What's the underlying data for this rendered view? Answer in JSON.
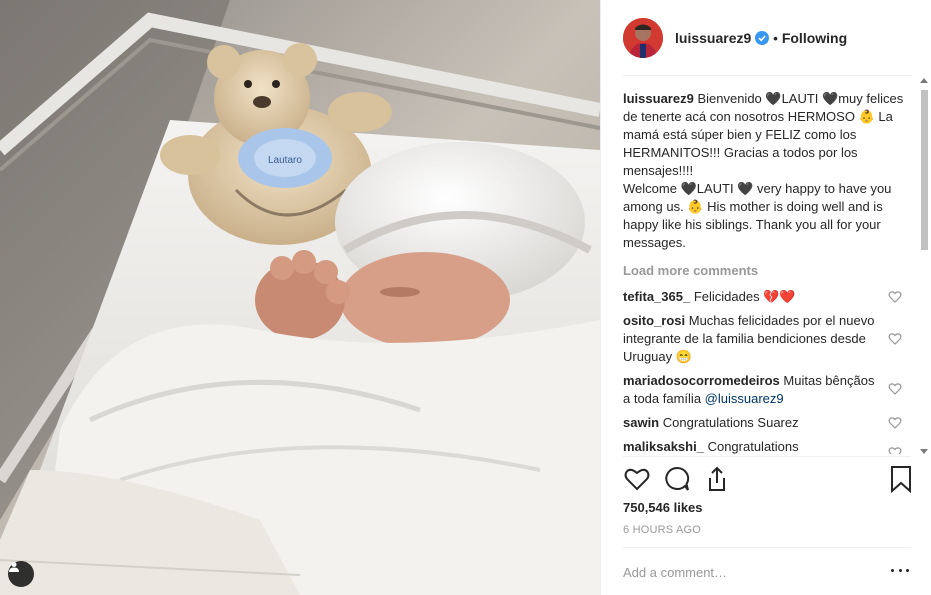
{
  "post": {
    "username": "luissuarez9",
    "separator": "•",
    "follow_label": "Following",
    "verified": true
  },
  "caption": {
    "username": "luissuarez9",
    "lines": [
      "Bienvenido 🖤LAUTI 🖤muy felices de tenerte acá con nosotros HERMOSO 👶 La mamá está súper bien y FELIZ como los HERMANITOS!!! Gracias a todos por los mensajes!!!!",
      "Welcome 🖤LAUTI 🖤 very happy to have you among us. 👶 His mother is doing well and is happy like his siblings. Thank you all for your messages."
    ]
  },
  "load_more_label": "Load more comments",
  "comments": [
    {
      "user": "tefita_365_",
      "text": "Felicidades 💔❤️"
    },
    {
      "user": "osito_rosi",
      "text": "Muchas felicidades por el nuevo integrante de la familia bendiciones desde Uruguay 😁"
    },
    {
      "user": "mariadosocorromedeiros",
      "text": "Muitas bênçãos a toda família",
      "mention": "@luissuarez9"
    },
    {
      "user": "sawin",
      "text": "Congratulations Suarez"
    },
    {
      "user": "maliksakshi_",
      "text": "Congratulations"
    }
  ],
  "likes": "750,546 likes",
  "time_ago": "6 HOURS AGO",
  "add_comment_placeholder": "Add a comment…",
  "icons": {
    "like": "heart-outline-icon",
    "comment": "speech-bubble-icon",
    "share": "share-upload-icon",
    "save": "bookmark-icon",
    "more": "ellipsis-icon",
    "tag": "user-tag-icon"
  },
  "colors": {
    "text": "#262626",
    "muted": "#999999",
    "divider": "#efefef",
    "verified": "#3897f0",
    "mention": "#003569"
  }
}
